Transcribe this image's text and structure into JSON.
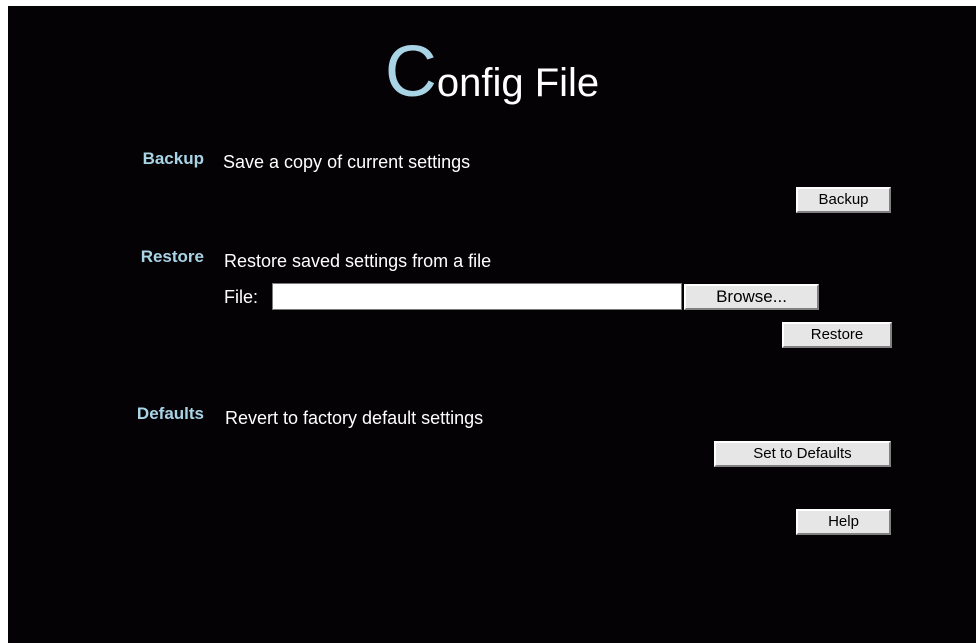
{
  "title": {
    "initial": "C",
    "rest": "onfig File"
  },
  "backup": {
    "label": "Backup",
    "description": "Save a copy of current settings",
    "button": "Backup"
  },
  "restore": {
    "label": "Restore",
    "description": "Restore saved settings from a file",
    "file_label": "File:",
    "file_value": "",
    "browse_button": "Browse...",
    "button": "Restore"
  },
  "defaults": {
    "label": "Defaults",
    "description": "Revert to factory default settings",
    "button": "Set to Defaults"
  },
  "help_button": "Help",
  "colors": {
    "background": "#050205",
    "accent": "#a8d4e6",
    "text": "#ffffff",
    "button_face": "#e6e6e6"
  }
}
